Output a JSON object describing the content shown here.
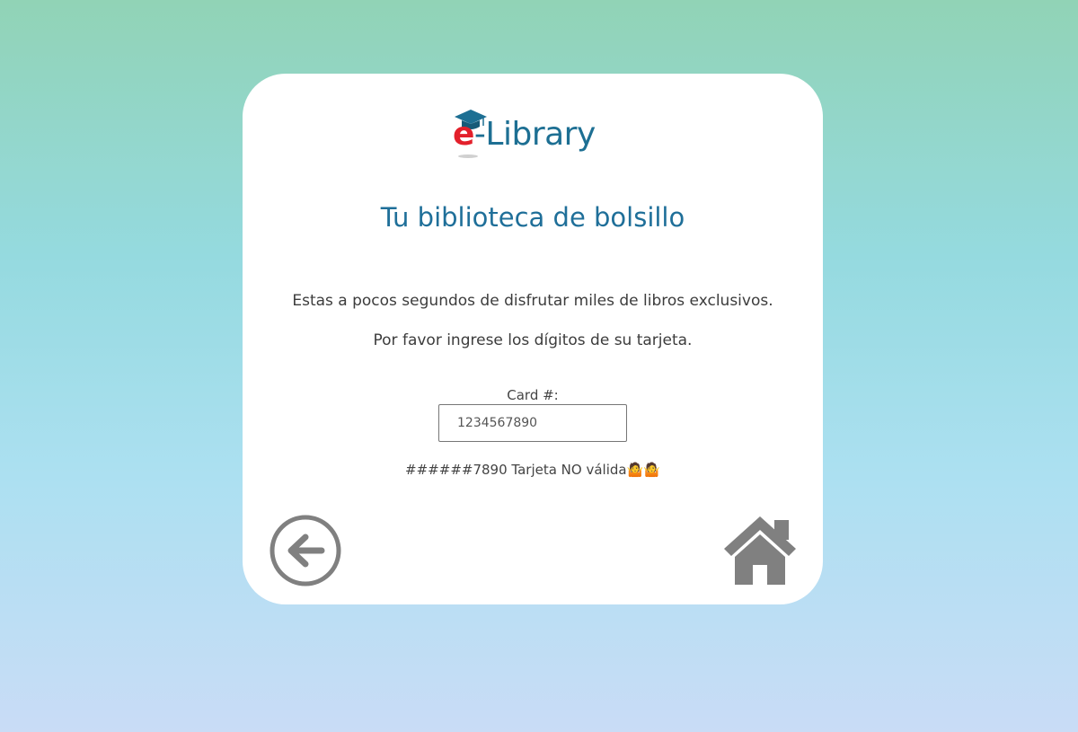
{
  "logo": {
    "letter_e": "e",
    "rest": "-Library"
  },
  "heading": "Tu biblioteca de bolsillo",
  "intro": "Estas a pocos segundos de disfrutar miles de libros exclusivos.",
  "instruction": "Por favor ingrese los dígitos de su tarjeta.",
  "form": {
    "card_label": "Card #:",
    "card_value": "1234567890"
  },
  "result": {
    "text": "######7890 Tarjeta NO válida",
    "emoji": "🤷🤷"
  },
  "nav": {
    "back_icon": "back-arrow-circle-icon",
    "home_icon": "home-icon"
  },
  "colors": {
    "title": "#1f6f99",
    "logo_blue": "#1d6f93",
    "logo_red": "#e3202b",
    "icon_gray": "#808080"
  }
}
